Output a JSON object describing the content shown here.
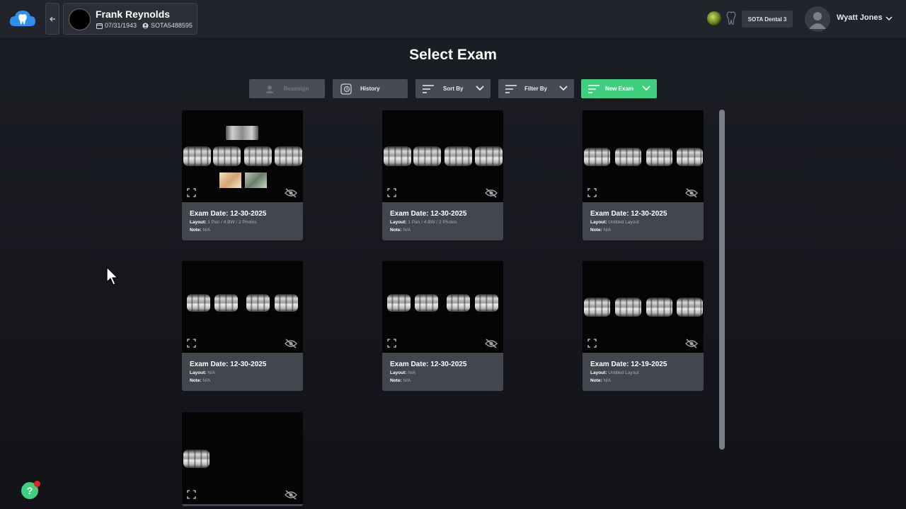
{
  "patient": {
    "name": "Frank Reynolds",
    "dob": "07/31/1943",
    "id": "SOTA5488595"
  },
  "header": {
    "practice": "SOTA Dental 3",
    "user_name": "Wyatt Jones"
  },
  "page_title": "Select Exam",
  "toolbar": {
    "reassign": "Reassign",
    "history": "History",
    "sort": "Sort By",
    "filter": "Filter By",
    "new_exam": "New Exam"
  },
  "labels": {
    "layout": "Layout:",
    "note": "Note:"
  },
  "exams": [
    {
      "date": "Exam Date: 12-30-2025",
      "layout": "1 Pan / 4 BW / 2 Photos",
      "note": "N/A"
    },
    {
      "date": "Exam Date: 12-30-2025",
      "layout": "1 Pan / 4 BW / 2 Photos",
      "note": "N/A"
    },
    {
      "date": "Exam Date: 12-30-2025",
      "layout": "Untitled Layout",
      "note": "N/A"
    },
    {
      "date": "Exam Date: 12-30-2025",
      "layout": "N/A",
      "note": "N/A"
    },
    {
      "date": "Exam Date: 12-30-2025",
      "layout": "N/A",
      "note": "N/A"
    },
    {
      "date": "Exam Date: 12-19-2025",
      "layout": "Untitled Layout",
      "note": "N/A"
    }
  ],
  "help": {
    "label": "?"
  },
  "colors": {
    "accent_green": "#3ecf7f",
    "notification_red": "#e0202a",
    "card_info_bg": "#43464f",
    "background": "#1b1d24"
  },
  "icons": [
    "cloud-tooth-logo-icon",
    "back-arrow-icon",
    "calendar-icon",
    "id-icon",
    "status-orb-icon",
    "tooth-icon",
    "user-avatar-icon",
    "chevron-down-icon",
    "reassign-icon",
    "history-icon",
    "sort-lines-icon",
    "expand-icon",
    "eye-slash-icon",
    "help-icon",
    "cursor-icon"
  ]
}
